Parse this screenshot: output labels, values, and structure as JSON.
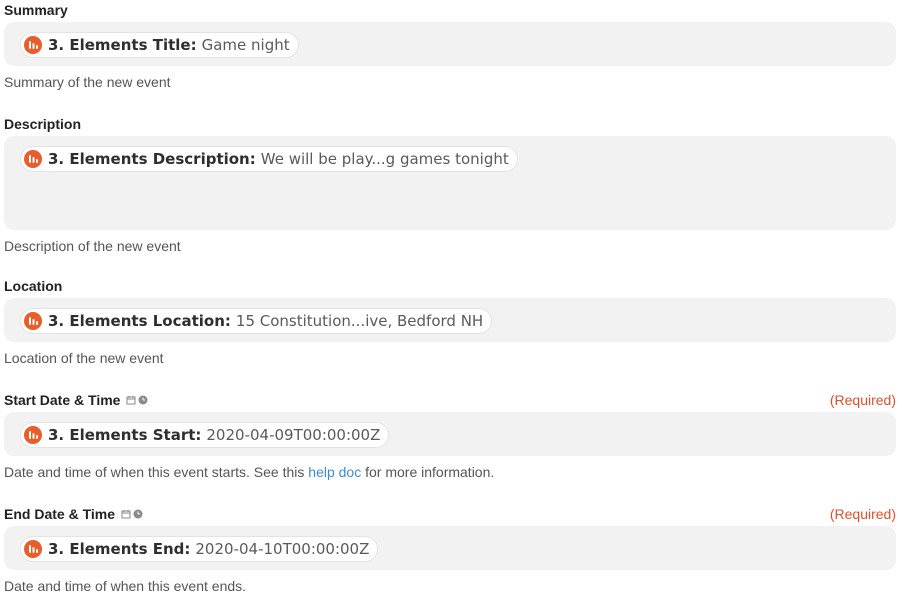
{
  "fields": [
    {
      "label": "Summary",
      "step": "3. Elements Title:",
      "value": "Game night",
      "help": "Summary of the new event"
    },
    {
      "label": "Description",
      "step": "3. Elements Description:",
      "value": "We will be play...g games tonight",
      "help": "Description of the new event"
    },
    {
      "label": "Location",
      "step": "3. Elements Location:",
      "value": "15 Constitution...ive, Bedford NH",
      "help": "Location of the new event"
    },
    {
      "label": "Start Date & Time",
      "required": "(Required)",
      "step": "3. Elements Start:",
      "value": "2020-04-09T00:00:00Z",
      "help_before": "Date and time of when this event starts. See this ",
      "help_link": "help doc",
      "help_after": " for more information."
    },
    {
      "label": "End Date & Time",
      "required": "(Required)",
      "step": "3. Elements End:",
      "value": "2020-04-10T00:00:00Z",
      "help": "Date and time of when this event ends."
    }
  ],
  "icons": {
    "app": "elements-app-icon",
    "calendar": "calendar-icon",
    "clock": "clock-icon"
  },
  "colors": {
    "app_icon": "#e85d2a",
    "required": "#e0502a",
    "link": "#3d8bd9",
    "field_bg": "#f2f2f2"
  }
}
